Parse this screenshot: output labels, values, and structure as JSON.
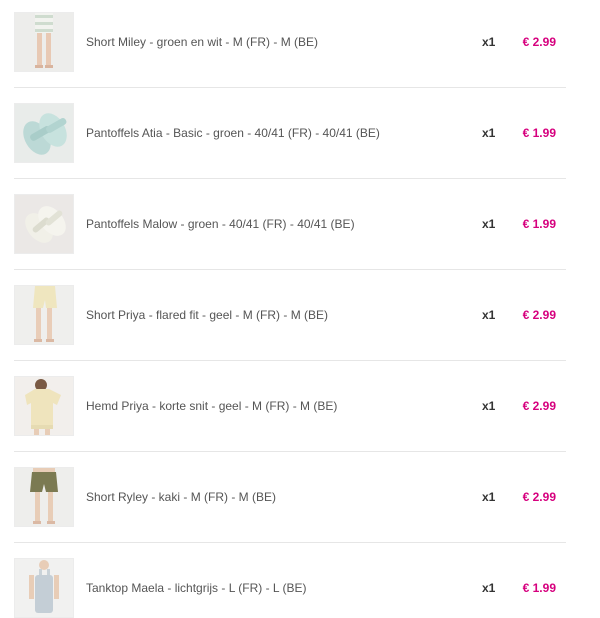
{
  "colors": {
    "price": "#d6007e",
    "divider": "#e6e6e6",
    "text": "#555555"
  },
  "order_items": [
    {
      "name": "Short Miley - groen en wit - M (FR) - M (BE)",
      "qty": "x1",
      "price": "€ 2.99",
      "image": "short-miley-product-image"
    },
    {
      "name": "Pantoffels Atia - Basic - groen - 40/41 (FR) - 40/41 (BE)",
      "qty": "x1",
      "price": "€ 1.99",
      "image": "pantoffels-atia-product-image"
    },
    {
      "name": "Pantoffels Malow - groen - 40/41 (FR) - 40/41 (BE)",
      "qty": "x1",
      "price": "€ 1.99",
      "image": "pantoffels-malow-product-image"
    },
    {
      "name": "Short Priya - flared fit - geel - M (FR) - M (BE)",
      "qty": "x1",
      "price": "€ 2.99",
      "image": "short-priya-product-image"
    },
    {
      "name": "Hemd Priya - korte snit - geel - M (FR) - M (BE)",
      "qty": "x1",
      "price": "€ 2.99",
      "image": "hemd-priya-product-image"
    },
    {
      "name": "Short Ryley - kaki - M (FR) - M (BE)",
      "qty": "x1",
      "price": "€ 2.99",
      "image": "short-ryley-product-image"
    },
    {
      "name": "Tanktop Maela - lichtgrijs - L (FR) - L (BE)",
      "qty": "x1",
      "price": "€ 1.99",
      "image": "tanktop-maela-product-image"
    }
  ]
}
